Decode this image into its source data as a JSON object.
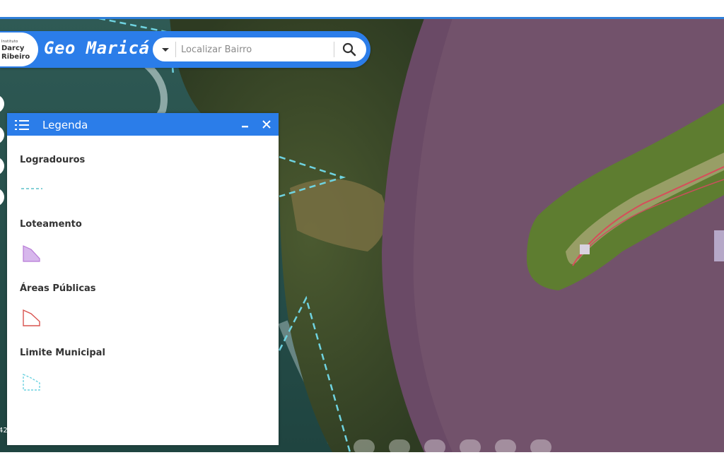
{
  "header": {
    "logo_line1": "Instituto",
    "logo_line2": "Darcy",
    "logo_line3": "Ribeiro",
    "title": "Geo Maricá"
  },
  "search": {
    "placeholder": "Localizar Bairro",
    "dropdown_icon": "caret-down-icon",
    "search_icon": "magnifier-icon"
  },
  "legend": {
    "title": "Legenda",
    "items": [
      {
        "label": "Logradouros",
        "symbol": "dashed-line",
        "color": "#5bc0c8"
      },
      {
        "label": "Loteamento",
        "symbol": "filled-polygon",
        "color": "#b77ad6"
      },
      {
        "label": "Áreas Públicas",
        "symbol": "outline-polygon",
        "color": "#d9534f"
      },
      {
        "label": "Limite Municipal",
        "symbol": "dashed-polygon",
        "color": "#6fd3e0"
      }
    ]
  },
  "map": {
    "corner_text": "42",
    "accent": "#2b7de9"
  }
}
